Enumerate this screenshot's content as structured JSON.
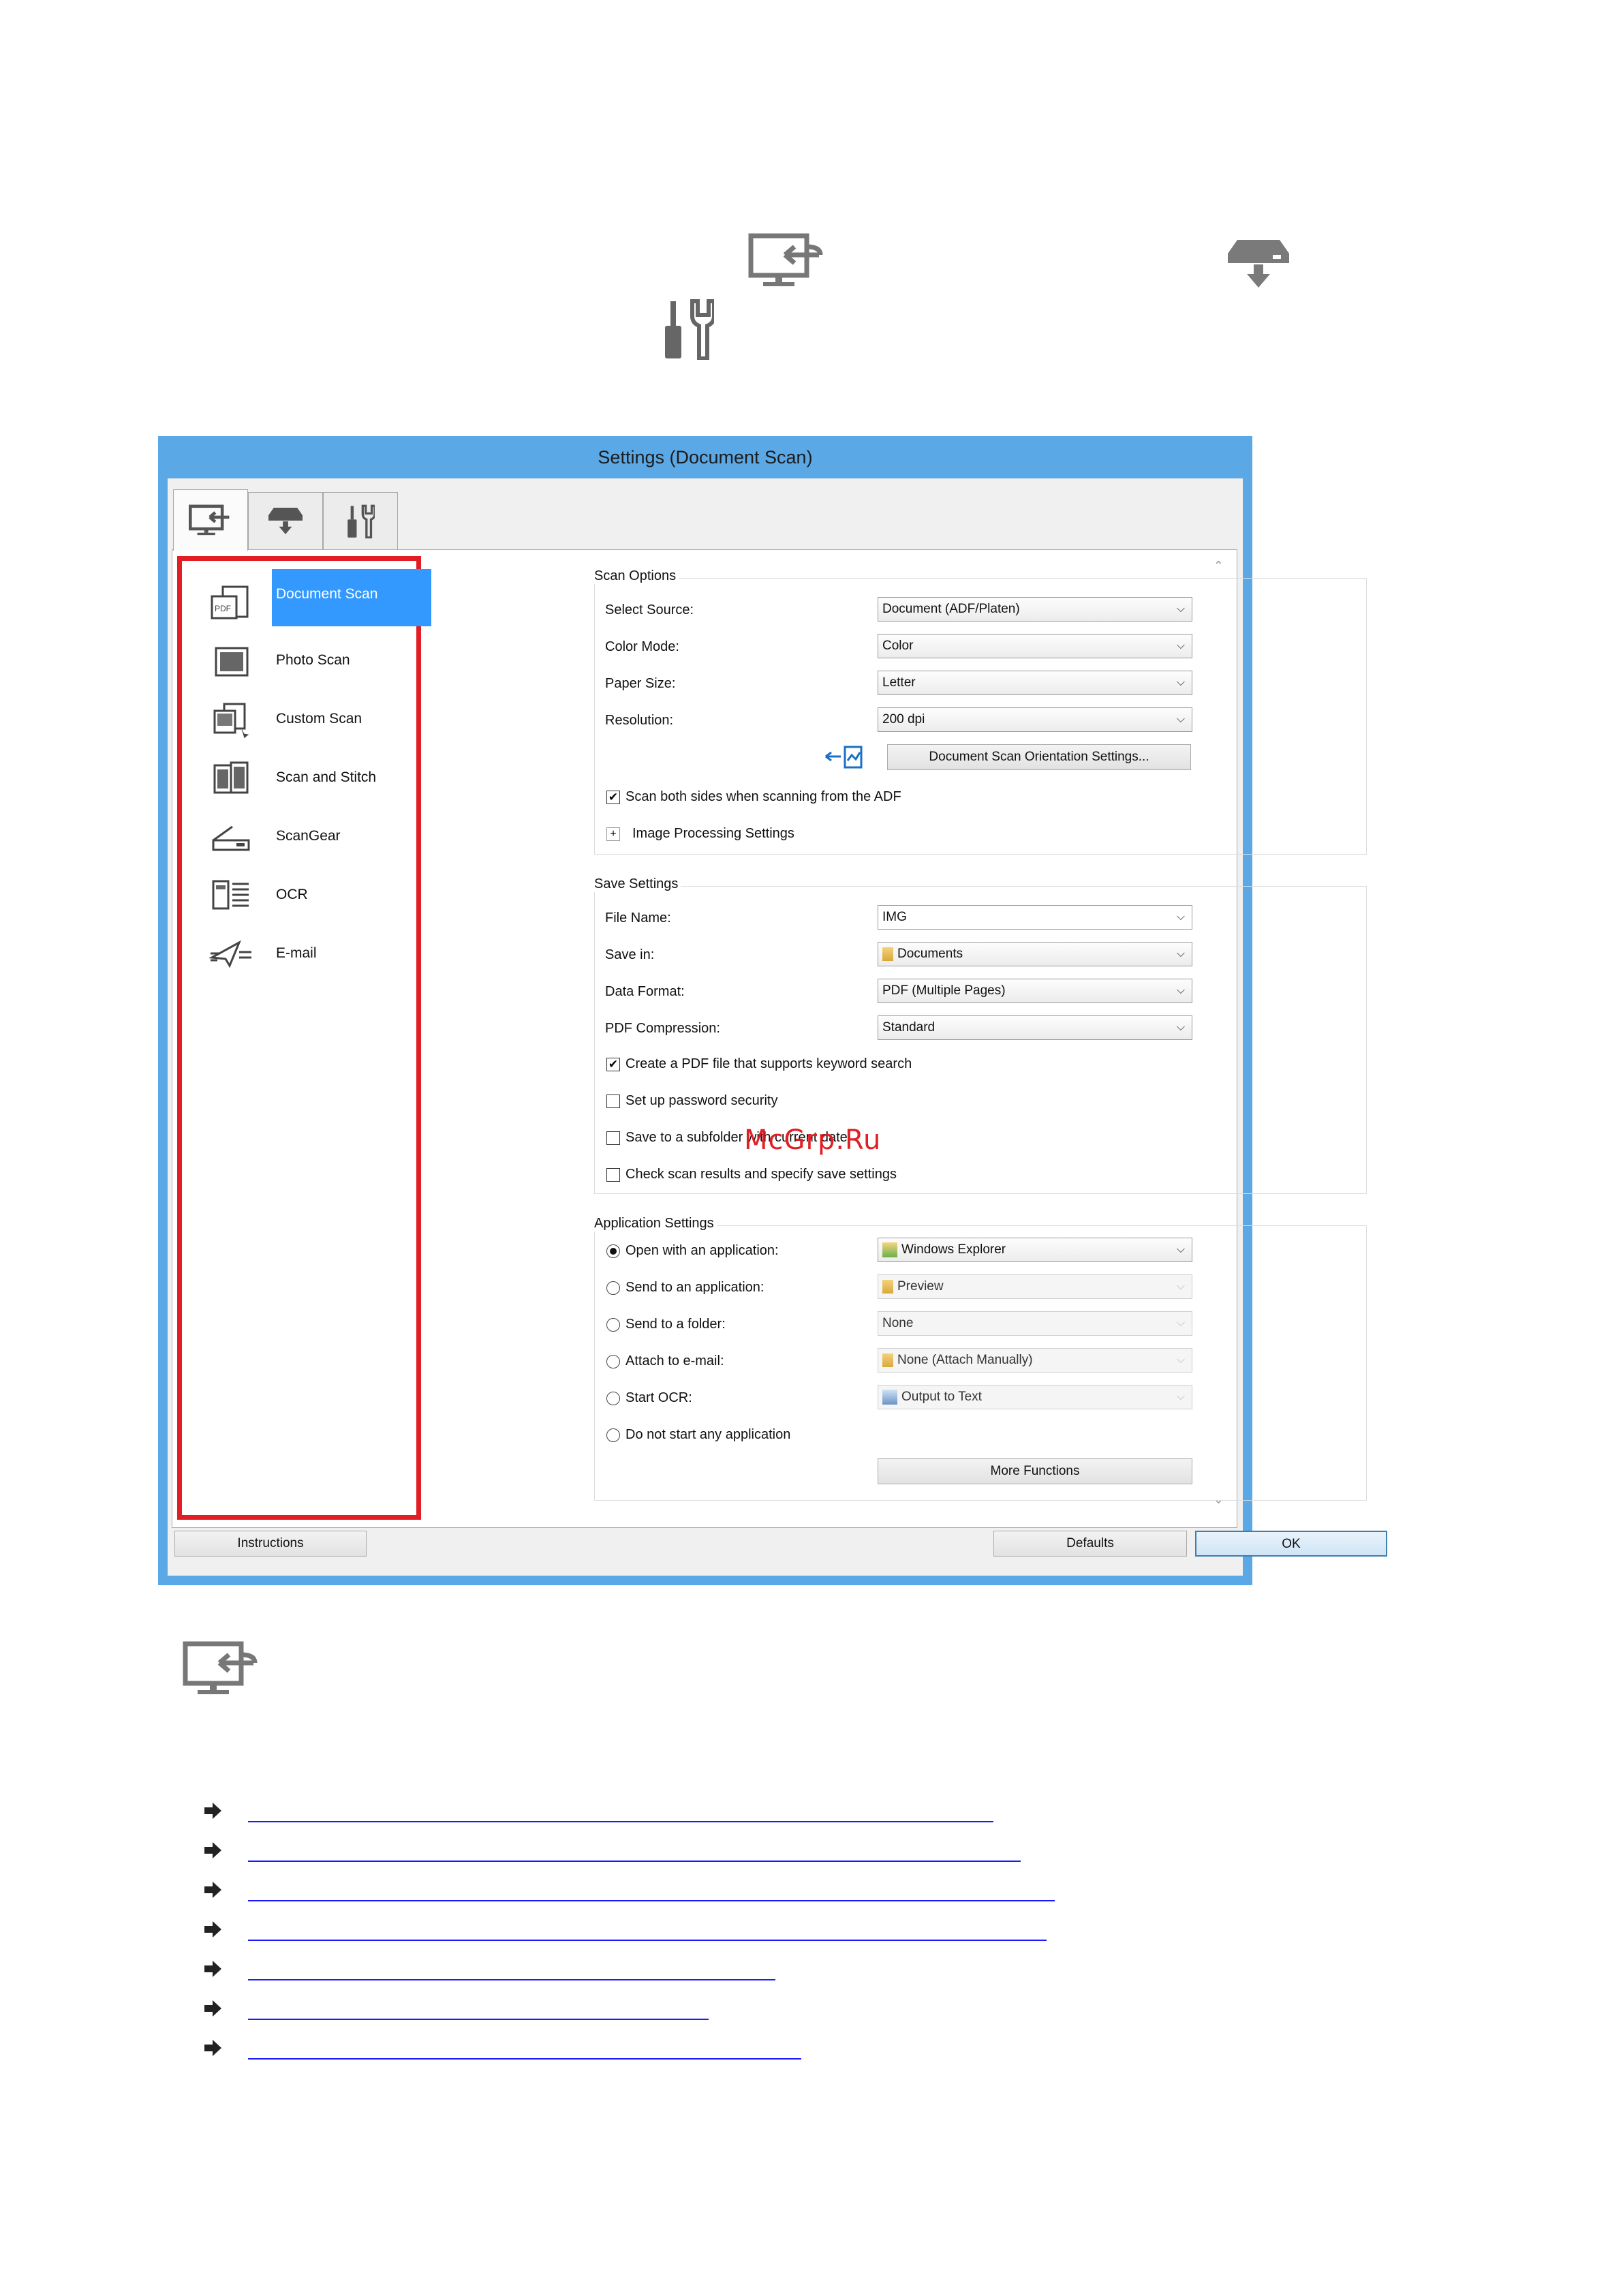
{
  "dialog": {
    "title": "Settings (Document Scan)",
    "tabs": [
      "scan-from-computer-icon",
      "scan-from-operation-panel-icon",
      "general-settings-icon"
    ]
  },
  "nav": {
    "items": [
      {
        "label": "Document Scan",
        "icon": "document-scan-icon",
        "selected": true
      },
      {
        "label": "Photo Scan",
        "icon": "photo-scan-icon"
      },
      {
        "label": "Custom Scan",
        "icon": "custom-scan-icon"
      },
      {
        "label": "Scan and Stitch",
        "icon": "scan-and-stitch-icon"
      },
      {
        "label": "ScanGear",
        "icon": "scangear-icon"
      },
      {
        "label": "OCR",
        "icon": "ocr-icon"
      },
      {
        "label": "E-mail",
        "icon": "email-icon"
      }
    ]
  },
  "scan_options": {
    "title": "Scan Options",
    "select_source_label": "Select Source:",
    "select_source_value": "Document (ADF/Platen)",
    "color_mode_label": "Color Mode:",
    "color_mode_value": "Color",
    "paper_size_label": "Paper Size:",
    "paper_size_value": "Letter",
    "resolution_label": "Resolution:",
    "resolution_value": "200 dpi",
    "orientation_button": "Document Scan Orientation Settings...",
    "scan_both_sides_label": "Scan both sides when scanning from the ADF",
    "scan_both_sides_checked": true,
    "image_processing_label": "Image Processing Settings"
  },
  "save_settings": {
    "title": "Save Settings",
    "file_name_label": "File Name:",
    "file_name_value": "IMG",
    "save_in_label": "Save in:",
    "save_in_value": "Documents",
    "data_format_label": "Data Format:",
    "data_format_value": "PDF (Multiple Pages)",
    "pdf_compression_label": "PDF Compression:",
    "pdf_compression_value": "Standard",
    "create_pdf_label": "Create a PDF file that supports keyword search",
    "create_pdf_checked": true,
    "password_label": "Set up password security",
    "subfolder_label": "Save to a subfolder with current date",
    "check_results_label": "Check scan results and specify save settings"
  },
  "application_settings": {
    "title": "Application Settings",
    "open_with_label": "Open with an application:",
    "open_with_value": "Windows Explorer",
    "send_to_app_label": "Send to an application:",
    "send_to_app_value": "Preview",
    "send_to_folder_label": "Send to a folder:",
    "send_to_folder_value": "None",
    "attach_email_label": "Attach to e-mail:",
    "attach_email_value": "None (Attach Manually)",
    "start_ocr_label": "Start OCR:",
    "start_ocr_value": "Output to Text",
    "do_not_start_label": "Do not start any application",
    "more_functions_button": "More Functions"
  },
  "footer": {
    "instructions_button": "Instructions",
    "defaults_button": "Defaults",
    "ok_button": "OK"
  },
  "watermark": "McGrp.Ru",
  "colors": {
    "dialog_frame": "#5aa8e6",
    "highlight_border": "#e01e24",
    "selection": "#3399ff",
    "link": "#1a1aff"
  }
}
